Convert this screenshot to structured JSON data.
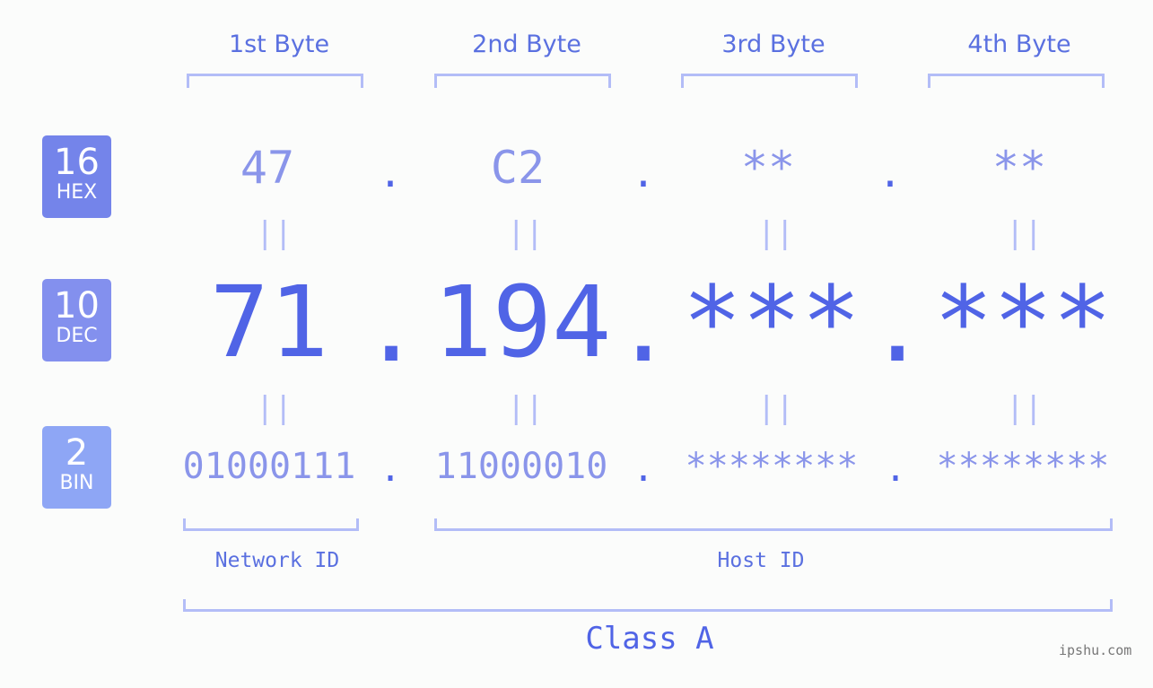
{
  "badges": [
    {
      "base": "16",
      "name": "HEX",
      "color": "#7484ea"
    },
    {
      "base": "10",
      "name": "DEC",
      "color": "#8390ee"
    },
    {
      "base": "2",
      "name": "BIN",
      "color": "#8ea6f5"
    }
  ],
  "bytes": [
    {
      "header": "1st Byte",
      "hex": "47",
      "dec": "71",
      "bin": "01000111"
    },
    {
      "header": "2nd Byte",
      "hex": "C2",
      "dec": "194",
      "bin": "11000010"
    },
    {
      "header": "3rd Byte",
      "hex": "**",
      "dec": "***",
      "bin": "********"
    },
    {
      "header": "4th Byte",
      "hex": "**",
      "dec": "***",
      "bin": "********"
    }
  ],
  "separator": ".",
  "equals": "||",
  "network_label": "Network ID",
  "host_label": "Host ID",
  "class_label": "Class A",
  "watermark": "ipshu.com"
}
